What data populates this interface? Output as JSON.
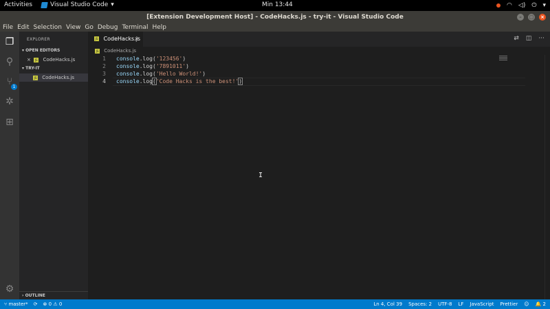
{
  "topbar": {
    "activities": "Activities",
    "app_name": "Visual Studio Code",
    "app_caret": "▾",
    "clock": "Min 13:44",
    "power_caret": "▾"
  },
  "window": {
    "title": "[Extension Development Host] - CodeHacks.js - try-it - Visual Studio Code",
    "minimize": "–",
    "maximize": "□",
    "close": "×"
  },
  "menu": [
    "File",
    "Edit",
    "Selection",
    "View",
    "Go",
    "Debug",
    "Terminal",
    "Help"
  ],
  "activity_bar": {
    "scm_badge": "1"
  },
  "sidebar": {
    "header": "EXPLORER",
    "open_editors_label": "OPEN EDITORS",
    "open_editors": [
      {
        "name": "CodeHacks.js",
        "close": "×"
      }
    ],
    "folder_label": "TRY-IT",
    "folder_files": [
      {
        "name": "CodeHacks.js"
      }
    ],
    "outline_label": "OUTLINE",
    "file_icon_text": "JS"
  },
  "editor": {
    "tab_label": "CodeHacks.js",
    "tab_close": "×",
    "breadcrumb": "CodeHacks.js",
    "lines": [
      {
        "num": "1",
        "obj": "console",
        "method": ".log(",
        "str": "'123456'",
        "close": ")"
      },
      {
        "num": "2",
        "obj": "console",
        "method": ".log(",
        "str": "'7891011'",
        "close": ")"
      },
      {
        "num": "3",
        "obj": "console",
        "method": ".log(",
        "str": "'Hello World!'",
        "close": ")"
      },
      {
        "num": "4",
        "obj": "console",
        "method": ".log",
        "open": "(",
        "str": "'Code Hacks is the best!'",
        "close": ")"
      }
    ],
    "cursor_glyph": "I"
  },
  "statusbar": {
    "branch": "master*",
    "errors": "0",
    "warnings": "0",
    "position": "Ln 4, Col 39",
    "spaces": "Spaces: 2",
    "encoding": "UTF-8",
    "eol": "LF",
    "language": "JavaScript",
    "formatter": "Prettier",
    "notifications": "2"
  },
  "colors": {
    "accent": "#007acc",
    "string": "#ce9178",
    "identifier": "#9cdcfe",
    "ubuntu_orange": "#e95420"
  }
}
